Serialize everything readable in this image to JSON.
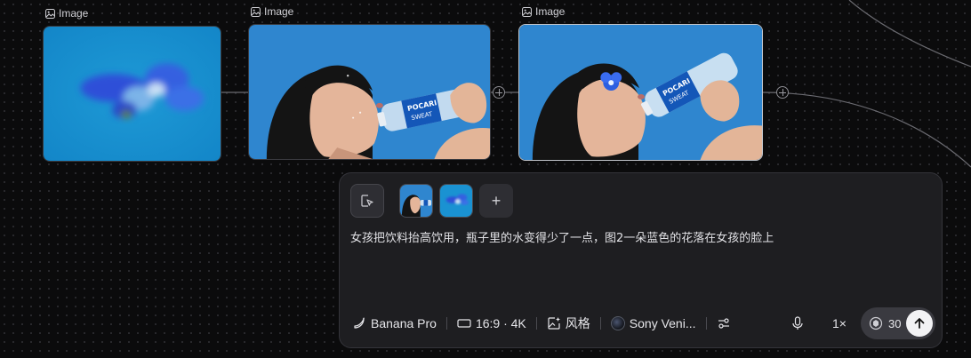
{
  "canvas": {
    "nodes": [
      {
        "label": "Image",
        "image": "blurred blue flower on blue background"
      },
      {
        "label": "Image",
        "image": "girl drinking from Pocari Sweat bottle against blue sky"
      },
      {
        "label": "Image",
        "image": "girl drinking with blue flower on her face"
      }
    ]
  },
  "composer": {
    "select_icon": "cursor-select-icon",
    "reference_thumbs": [
      {
        "name": "reference-image-girl"
      },
      {
        "name": "reference-image-flower"
      }
    ],
    "add_reference_label": "+",
    "prompt": "女孩把饮料抬高饮用，瓶子里的水变得少了一点，图2一朵蓝色的花落在女孩的脸上",
    "toolbar": {
      "model": "Banana Pro",
      "aspect": "16:9 · 4K",
      "style": "风格",
      "camera": "Sony Veni...",
      "settings_icon": "sliders-icon",
      "mic_icon": "mic-icon",
      "speed": "1×"
    },
    "credits": "30",
    "send_icon": "arrow-up-icon"
  },
  "colors": {
    "canvas_bg": "#0b0b0c",
    "panel_bg": "#1e1e21",
    "sky_blue": "#2f86cf"
  }
}
